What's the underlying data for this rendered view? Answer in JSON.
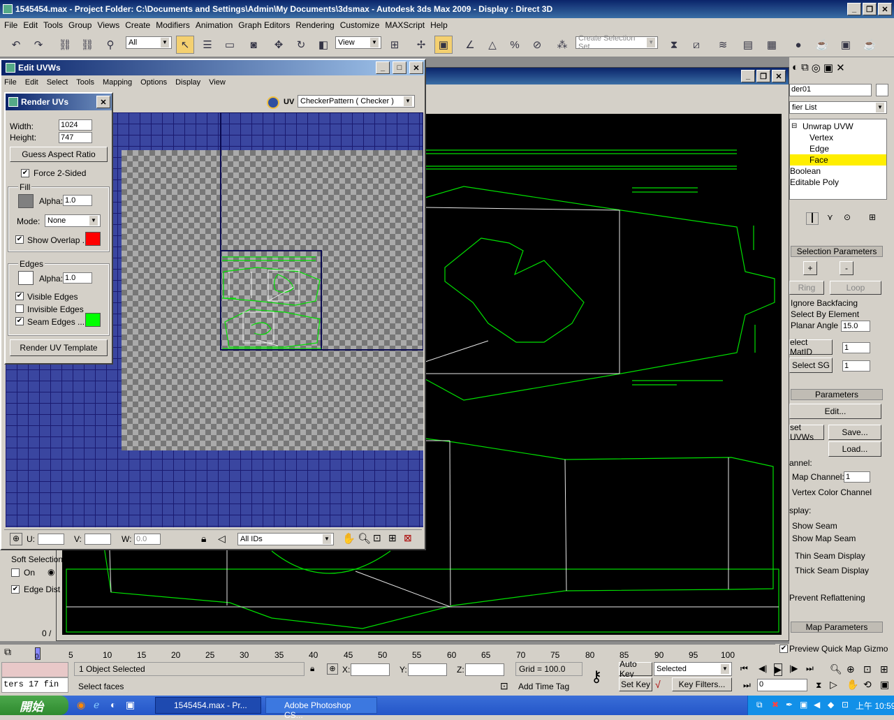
{
  "app": {
    "title": "1545454.max  - Project Folder: C:\\Documents and Settings\\Admin\\My Documents\\3dsmax    - Autodesk 3ds Max  2009      - Display : Direct 3D"
  },
  "menu": [
    "File",
    "Edit",
    "Tools",
    "Group",
    "Views",
    "Create",
    "Modifiers",
    "Animation",
    "Graph Editors",
    "Rendering",
    "Customize",
    "MAXScript",
    "Help"
  ],
  "toolbar": {
    "filter": "All",
    "refcoord": "View",
    "selset_placeholder": "Create Selection Set"
  },
  "edituvw": {
    "title": "Edit UVWs",
    "menu": [
      "File",
      "Edit",
      "Select",
      "Tools",
      "Mapping",
      "Options",
      "Display",
      "View"
    ],
    "uv_label": "UV",
    "map": "CheckerPattern  ( Checker )",
    "u_label": "U:",
    "v_label": "V:",
    "w_label": "W:",
    "w_value": "0.0",
    "ids": "All IDs"
  },
  "renderuvs": {
    "title": "Render UVs",
    "width_label": "Width:",
    "width": "1024",
    "height_label": "Height:",
    "height": "747",
    "guess": "Guess Aspect Ratio",
    "force2": "Force 2-Sided",
    "fill": "Fill",
    "alpha_label": "Alpha:",
    "fill_alpha": "1.0",
    "mode_label": "Mode:",
    "mode": "None",
    "show_overlap": "Show Overlap ...",
    "edges": "Edges",
    "edge_alpha": "1.0",
    "visible_edges": "Visible Edges",
    "invisible_edges": "Invisible Edges",
    "seam_edges": "Seam Edges ....",
    "render": "Render UV Template",
    "fill_color": "#808080",
    "overlap_color": "#ff0000",
    "edge_color": "#ffffff",
    "seam_color": "#00ff00"
  },
  "softsel": {
    "title": "Soft Selection",
    "on": "On",
    "edge_dist": "Edge Dist",
    "counter": "0 /"
  },
  "cmdpanel": {
    "name": "der01",
    "modlist": "fier List",
    "stack": [
      "Unwrap UVW",
      "Vertex",
      "Edge",
      "Face",
      "Boolean",
      "Editable Poly"
    ],
    "selparams": "Selection Parameters",
    "ring": "Ring",
    "loop": "Loop",
    "ignore_bf": "Ignore Backfacing",
    "select_elem": "Select By Element",
    "planar": "Planar Angle",
    "planar_val": "15.0",
    "matid": "elect MatID",
    "matid_val": "1",
    "sg": "Select SG",
    "sg_val": "1",
    "params": "Parameters",
    "edit": "Edit...",
    "reset": "set UVWs",
    "save": "Save...",
    "load": "Load...",
    "channel": "annel:",
    "mapch": "Map Channel:",
    "mapch_val": "1",
    "vcc": "Vertex Color Channel",
    "display": "splay:",
    "show_seam": "Show Seam",
    "show_map_seam": "Show Map Seam",
    "thin": "Thin Seam Display",
    "thick": "Thick Seam Display",
    "prevent": "Prevent Reflattening",
    "mapparams": "Map Parameters",
    "preview": "Preview Quick Map Gizmo"
  },
  "timeline": {
    "ticks": [
      "5",
      "10",
      "15",
      "20",
      "25",
      "30",
      "35",
      "40",
      "45",
      "50",
      "55",
      "60",
      "65",
      "70",
      "75",
      "80",
      "85",
      "90",
      "95",
      "100"
    ],
    "frame": "0"
  },
  "status": {
    "objects": "1 Object Selected",
    "prompt": "Select faces",
    "x": "X:",
    "y": "Y:",
    "z": "Z:",
    "grid": "Grid = 100.0",
    "addtime": "Add Time Tag",
    "autokey": "Auto Key",
    "selected": "Selected",
    "setkey": "Set Key",
    "keyfilters": "Key Filters...",
    "frame": "0",
    "script": "ters 17 fin"
  },
  "taskbar": {
    "start": "開始",
    "task1": "1545454.max    - Pr...",
    "task2": "Adobe Photoshop CS...",
    "clock": "上午 10:59"
  }
}
